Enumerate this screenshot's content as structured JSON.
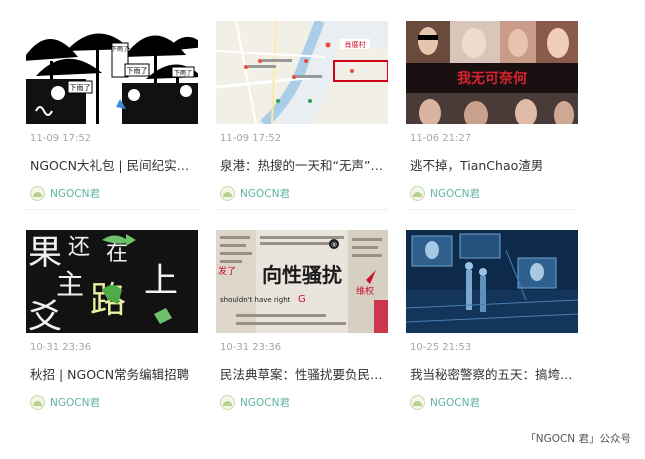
{
  "articles": [
    {
      "date": "11-09 17:52",
      "title": "NGOCN大礼包 | 民间纪实…",
      "author": "NGOCN君",
      "thumb_text": [
        "下雨了",
        "下雨了",
        "下雨了",
        "下雨了"
      ]
    },
    {
      "date": "11-09 17:52",
      "title": "泉港：热搜的一天和“无声”…",
      "author": "NGOCN君",
      "thumb_text": [
        "肖厝村"
      ]
    },
    {
      "date": "11-06 21:27",
      "title": "逃不掉，TianChao渣男",
      "author": "NGOCN君",
      "thumb_text": [
        "我无可奈何"
      ]
    },
    {
      "date": "10-31 23:36",
      "title": "秋招 | NGOCN常务编辑招聘",
      "author": "NGOCN君",
      "thumb_text": [
        "果",
        "还",
        "在",
        "主",
        "路",
        "上",
        "爻"
      ]
    },
    {
      "date": "10-31 23:36",
      "title": "民法典草案：性骚扰要负民…",
      "author": "NGOCN君",
      "thumb_text": [
        "向性骚扰",
        "shouldn't have right",
        "G",
        "⑨",
        "发了",
        "维权"
      ]
    },
    {
      "date": "10-25 21:53",
      "title": "我当秘密警察的五天：搞垮…",
      "author": "NGOCN君",
      "thumb_text": []
    }
  ],
  "footer": {
    "text": "「NGOCN 君」公众号"
  },
  "colors": {
    "author": "#5fb3a4",
    "date": "#a6a6a6",
    "title": "#333333",
    "banner_red": "#c8102e"
  }
}
